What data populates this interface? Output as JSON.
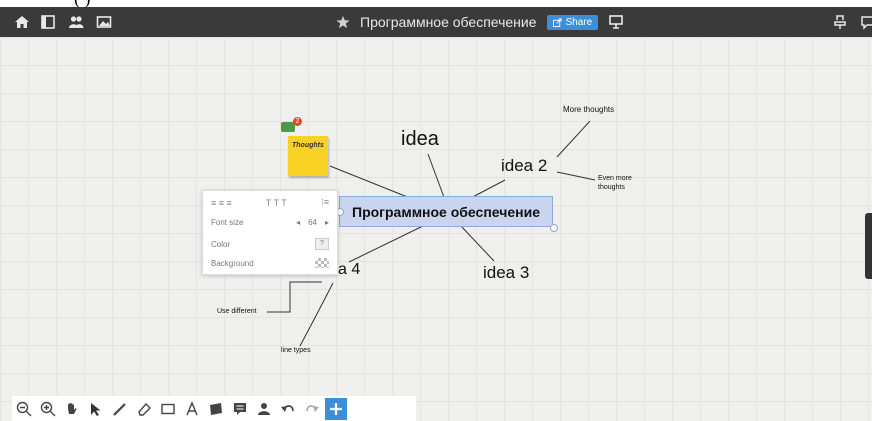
{
  "strip_text": "(   )",
  "header": {
    "title": "Программное обеспечение",
    "share_label": "Share"
  },
  "map": {
    "central": "Программное обеспечение",
    "idea1": "idea",
    "idea2": "idea 2",
    "idea3": "idea 3",
    "idea4": "a 4",
    "more_thoughts": "More thoughts",
    "even_more_1": "Even more",
    "even_more_2": "thoughts",
    "use_different": "Use different",
    "line_types": "line types",
    "sticky_text": "Thoughts",
    "badge": "2"
  },
  "format_panel": {
    "align_icons": "≡ ≡ ≡",
    "text_icons": "T T T",
    "list_icon": "⁝≡",
    "font_size_label": "Font size",
    "font_size_value": "64",
    "color_label": "Color",
    "color_value": "?",
    "background_label": "Background"
  }
}
